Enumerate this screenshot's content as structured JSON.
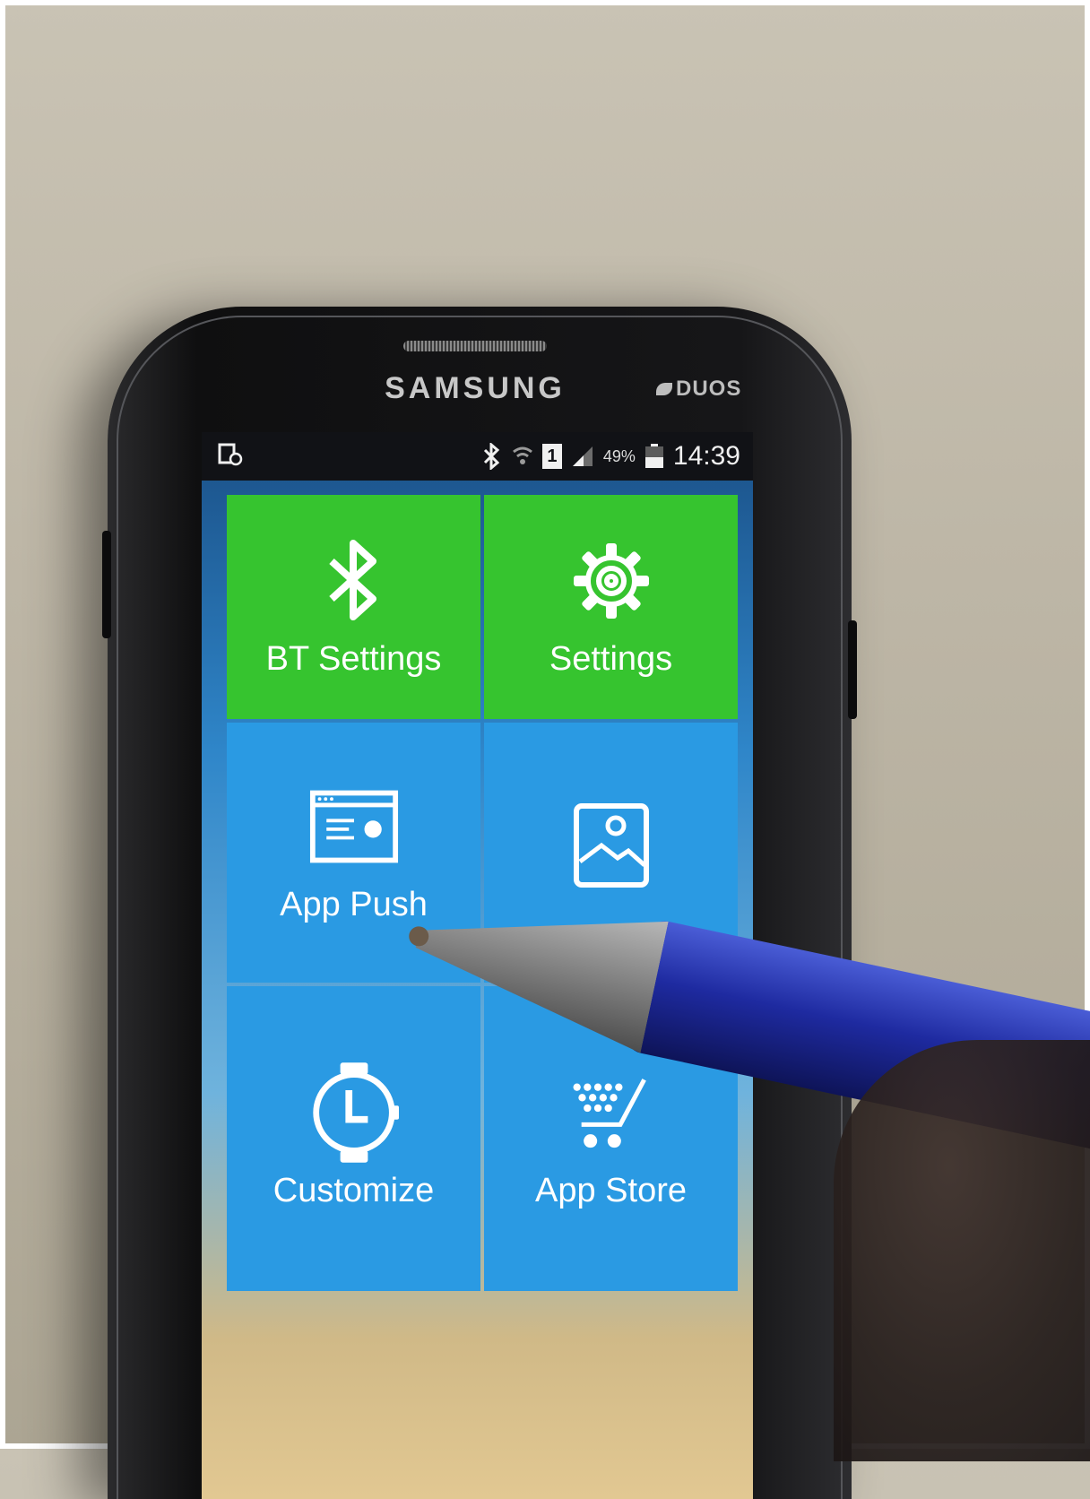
{
  "device": {
    "brand": "SAMSUNG",
    "model_badge": "DUOS"
  },
  "status_bar": {
    "battery_percent": "49%",
    "time": "14:39",
    "sim_slot": "1",
    "icons": [
      "screen-recorder-icon",
      "bluetooth-icon",
      "wifi-icon",
      "sim-icon",
      "signal-icon",
      "battery-icon"
    ]
  },
  "tiles": [
    {
      "label": "BT Settings",
      "icon": "bluetooth-icon",
      "color": "#36c42f"
    },
    {
      "label": "Settings",
      "icon": "gear-icon",
      "color": "#36c42f"
    },
    {
      "label": "App Push",
      "icon": "app-window-icon",
      "color": "#2a9ae3"
    },
    {
      "label": "",
      "icon": "gallery-icon",
      "color": "#2a9ae3"
    },
    {
      "label": "Customize",
      "icon": "watch-icon",
      "color": "#2a9ae3"
    },
    {
      "label": "App Store",
      "icon": "cart-icon",
      "color": "#2a9ae3"
    }
  ]
}
